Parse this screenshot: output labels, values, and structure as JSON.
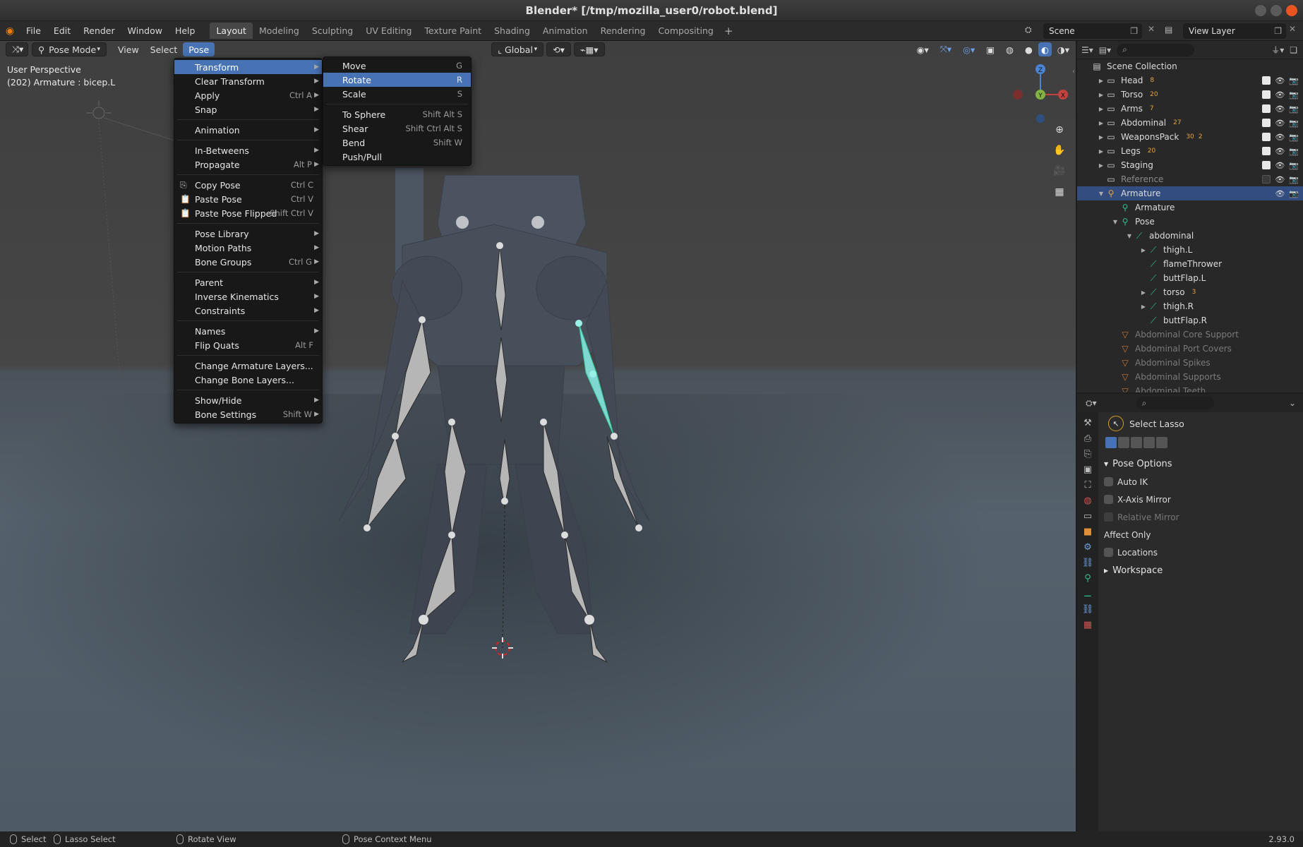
{
  "window": {
    "title": "Blender* [/tmp/mozilla_user0/robot.blend]"
  },
  "topbar": {
    "menus": [
      "File",
      "Edit",
      "Render",
      "Window",
      "Help"
    ],
    "tabs": [
      "Layout",
      "Modeling",
      "Sculpting",
      "UV Editing",
      "Texture Paint",
      "Shading",
      "Animation",
      "Rendering",
      "Compositing"
    ],
    "active_tab": "Layout",
    "add_tab": "+",
    "scene": "Scene",
    "view_layer": "View Layer"
  },
  "viewport_header": {
    "mode": "Pose Mode",
    "view": "View",
    "select": "Select",
    "pose": "Pose",
    "orientation": "Global"
  },
  "viewport": {
    "perspective": "User Perspective",
    "active": "(202) Armature : bicep.L",
    "gizmo_axes": {
      "z": "Z",
      "x": "X",
      "y": "Y"
    }
  },
  "pose_menu": {
    "items": [
      {
        "label": "Transform",
        "shortcut": "",
        "submenu": true,
        "highlight": true
      },
      {
        "label": "Clear Transform",
        "shortcut": "",
        "submenu": true
      },
      {
        "label": "Apply",
        "shortcut": "Ctrl A",
        "submenu": true
      },
      {
        "label": "Snap",
        "shortcut": "",
        "submenu": true
      },
      {
        "sep": true
      },
      {
        "label": "Animation",
        "shortcut": "",
        "submenu": true
      },
      {
        "sep": true
      },
      {
        "label": "In-Betweens",
        "shortcut": "",
        "submenu": true
      },
      {
        "label": "Propagate",
        "shortcut": "Alt P",
        "submenu": true
      },
      {
        "sep": true
      },
      {
        "label": "Copy Pose",
        "shortcut": "Ctrl C",
        "icon": "copy"
      },
      {
        "label": "Paste Pose",
        "shortcut": "Ctrl V",
        "icon": "paste"
      },
      {
        "label": "Paste Pose Flipped",
        "shortcut": "Shift Ctrl V",
        "icon": "paste"
      },
      {
        "sep": true
      },
      {
        "label": "Pose Library",
        "shortcut": "",
        "submenu": true
      },
      {
        "label": "Motion Paths",
        "shortcut": "",
        "submenu": true
      },
      {
        "label": "Bone Groups",
        "shortcut": "Ctrl G",
        "submenu": true
      },
      {
        "sep": true
      },
      {
        "label": "Parent",
        "shortcut": "",
        "submenu": true
      },
      {
        "label": "Inverse Kinematics",
        "shortcut": "",
        "submenu": true
      },
      {
        "label": "Constraints",
        "shortcut": "",
        "submenu": true
      },
      {
        "sep": true
      },
      {
        "label": "Names",
        "shortcut": "",
        "submenu": true
      },
      {
        "label": "Flip Quats",
        "shortcut": "Alt F"
      },
      {
        "sep": true
      },
      {
        "label": "Change Armature Layers...",
        "shortcut": ""
      },
      {
        "label": "Change Bone Layers...",
        "shortcut": ""
      },
      {
        "sep": true
      },
      {
        "label": "Show/Hide",
        "shortcut": "",
        "submenu": true
      },
      {
        "label": "Bone Settings",
        "shortcut": "Shift W",
        "submenu": true
      }
    ]
  },
  "transform_menu": {
    "items": [
      {
        "label": "Move",
        "shortcut": "G"
      },
      {
        "label": "Rotate",
        "shortcut": "R",
        "highlight": true
      },
      {
        "label": "Scale",
        "shortcut": "S"
      },
      {
        "sep": true
      },
      {
        "label": "To Sphere",
        "shortcut": "Shift Alt S"
      },
      {
        "label": "Shear",
        "shortcut": "Shift Ctrl Alt S"
      },
      {
        "label": "Bend",
        "shortcut": "Shift W"
      },
      {
        "label": "Push/Pull",
        "shortcut": ""
      }
    ]
  },
  "outliner": {
    "rows": [
      {
        "label": "Scene Collection",
        "indent": 0,
        "icon": "scene",
        "twisty": ""
      },
      {
        "label": "Head",
        "indent": 1,
        "icon": "collection",
        "twisty": "▶",
        "badge": "8",
        "checked": true
      },
      {
        "label": "Torso",
        "indent": 1,
        "icon": "collection",
        "twisty": "▶",
        "badge": "20",
        "checked": true
      },
      {
        "label": "Arms",
        "indent": 1,
        "icon": "collection",
        "twisty": "▶",
        "badge": "7",
        "checked": true
      },
      {
        "label": "Abdominal",
        "indent": 1,
        "icon": "collection",
        "twisty": "▶",
        "badge": "27",
        "checked": true
      },
      {
        "label": "WeaponsPack",
        "indent": 1,
        "icon": "collection",
        "twisty": "▶",
        "badge": "30",
        "badge2": "2",
        "checked": true
      },
      {
        "label": "Legs",
        "indent": 1,
        "icon": "collection",
        "twisty": "▶",
        "badge": "20",
        "checked": true
      },
      {
        "label": "Staging",
        "indent": 1,
        "icon": "collection",
        "twisty": "▶",
        "badge": "",
        "checked": true
      },
      {
        "label": "Reference",
        "indent": 1,
        "icon": "collection",
        "twisty": "",
        "dim": true,
        "checked": false
      },
      {
        "label": "Armature",
        "indent": 1,
        "icon": "armature",
        "twisty": "▼",
        "selected": true
      },
      {
        "label": "Armature",
        "indent": 2,
        "icon": "armature-data",
        "twisty": ""
      },
      {
        "label": "Pose",
        "indent": 2,
        "icon": "pose",
        "twisty": "▼"
      },
      {
        "label": "abdominal",
        "indent": 3,
        "icon": "bone",
        "twisty": "▼"
      },
      {
        "label": "thigh.L",
        "indent": 4,
        "icon": "bone",
        "twisty": "▶"
      },
      {
        "label": "flameThrower",
        "indent": 4,
        "icon": "bone",
        "twisty": ""
      },
      {
        "label": "buttFlap.L",
        "indent": 4,
        "icon": "bone",
        "twisty": ""
      },
      {
        "label": "torso",
        "indent": 4,
        "icon": "bone",
        "twisty": "▶",
        "badge": "3"
      },
      {
        "label": "thigh.R",
        "indent": 4,
        "icon": "bone",
        "twisty": "▶"
      },
      {
        "label": "buttFlap.R",
        "indent": 4,
        "icon": "bone",
        "twisty": ""
      },
      {
        "label": "Abdominal Core Support",
        "indent": 2,
        "icon": "mesh",
        "mesh": true
      },
      {
        "label": "Abdominal Port Covers",
        "indent": 2,
        "icon": "mesh",
        "mesh": true
      },
      {
        "label": "Abdominal Spikes",
        "indent": 2,
        "icon": "mesh",
        "mesh": true
      },
      {
        "label": "Abdominal Supports",
        "indent": 2,
        "icon": "mesh",
        "mesh": true
      },
      {
        "label": "Abdominal Teeth",
        "indent": 2,
        "icon": "mesh",
        "mesh": true
      }
    ]
  },
  "properties": {
    "tool": "Select Lasso",
    "sections": {
      "pose_options": "Pose Options",
      "auto_ik": "Auto IK",
      "x_axis_mirror": "X-Axis Mirror",
      "relative_mirror": "Relative Mirror",
      "affect_only": "Affect Only",
      "locations": "Locations",
      "workspace": "Workspace"
    }
  },
  "statusbar": {
    "select": "Select",
    "lasso": "Lasso Select",
    "rotate": "Rotate View",
    "context": "Pose Context Menu",
    "version": "2.93.0"
  },
  "colors": {
    "accent": "#4772b3",
    "selected_row": "#334d80",
    "bone_green": "#2fbf8f",
    "blender_orange": "#e87d0d"
  }
}
